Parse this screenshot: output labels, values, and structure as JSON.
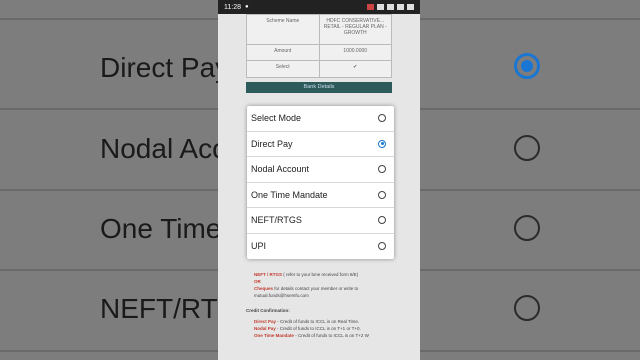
{
  "status_bar": {
    "time": "11:28",
    "dot": "●"
  },
  "scheme_table": {
    "rows": [
      {
        "label": "Scheme Name",
        "value": "HDFC CONSERVATIVE... RETAIL - REGULAR PLAN - GROWTH"
      },
      {
        "label": "Amount",
        "value": "1000.0000"
      },
      {
        "label": "Select",
        "value": "✔"
      }
    ]
  },
  "bank_details_label": "Bank Details",
  "dialog": {
    "title": "Select Mode",
    "options": [
      {
        "label": "Direct Pay",
        "selected": true
      },
      {
        "label": "Nodal Account",
        "selected": false
      },
      {
        "label": "One Time Mandate",
        "selected": false
      },
      {
        "label": "NEFT/RTGS",
        "selected": false
      },
      {
        "label": "UPI",
        "selected": false
      }
    ]
  },
  "lower": {
    "neft_label": "NEFT / RTGS",
    "neft_note": "( refer to your bme received form 8/E)",
    "or": "OR",
    "cheques_label": "Cheques",
    "cheques_note": "for details contact your member or write to mutual.funds@hsemfu.com",
    "credit_heading": "Credit Confirmation:",
    "credit_items": [
      {
        "label": "Direct Pay",
        "note": "- Credit of funds to ICCL is on Real Time."
      },
      {
        "label": "Nodal Pay",
        "note": "- Credit of funds to ICCL is on T+1 or T+0."
      },
      {
        "label": "One Time Mandate",
        "note": "- Credit of funds to ICCL is on T+2 W"
      }
    ]
  },
  "background": {
    "left_items": [
      "Direct Pay",
      "Nodal Acco",
      "One Time",
      "NEFT/RTG"
    ],
    "selected_index": 0
  },
  "colors": {
    "accent": "#1976d2",
    "bank_bar": "#2d5b5b"
  }
}
